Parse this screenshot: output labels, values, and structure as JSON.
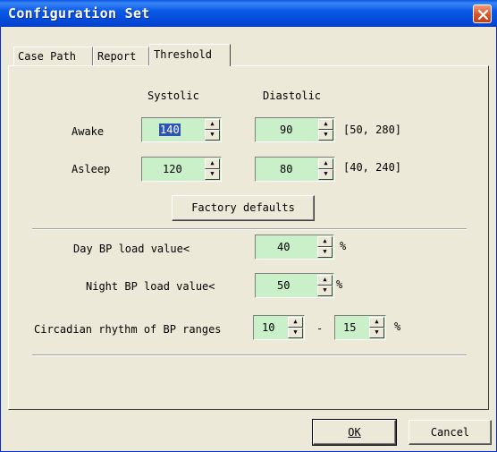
{
  "window": {
    "title": "Configuration Set"
  },
  "tabs": [
    {
      "label": "Case Path"
    },
    {
      "label": "Report"
    },
    {
      "label": "Threshold",
      "active": true
    }
  ],
  "threshold": {
    "systolic_header": "Systolic",
    "diastolic_header": "Diastolic",
    "awake": {
      "label": "Awake",
      "systolic": "140",
      "diastolic": "90",
      "range": "[50, 280]"
    },
    "asleep": {
      "label": "Asleep",
      "systolic": "120",
      "diastolic": "80",
      "range": "[40, 240]"
    },
    "factory_defaults_label": "Factory defaults"
  },
  "load": {
    "day_label": "Day BP load value<",
    "day_value": "40",
    "night_label": "Night BP load value<",
    "night_value": "50",
    "percent": "%"
  },
  "circadian": {
    "label": "Circadian rhythm of BP ranges",
    "from": "10",
    "dash": "-",
    "to": "15",
    "percent": "%"
  },
  "buttons": {
    "ok": "OK",
    "cancel": "Cancel"
  },
  "colors": {
    "titlebar": "#0a5ae8",
    "field_bg": "#c9f0c9",
    "dialog_bg": "#ece9d8",
    "close": "#d9542a"
  }
}
